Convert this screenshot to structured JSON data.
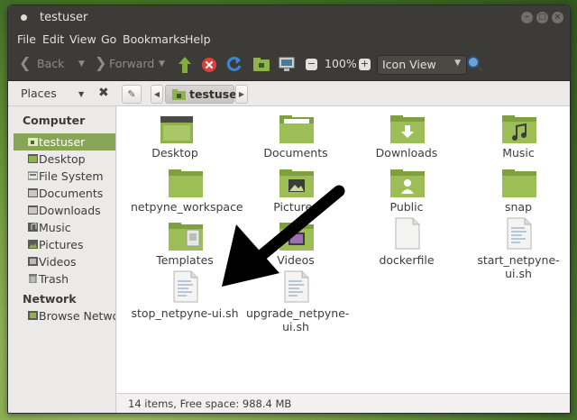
{
  "window": {
    "title": "testuser"
  },
  "menu": [
    "File",
    "Edit",
    "View",
    "Go",
    "Bookmarks",
    "Help"
  ],
  "toolbar": {
    "back_label": "Back",
    "forward_label": "Forward",
    "zoom": "100%",
    "view_mode": "Icon View"
  },
  "location": {
    "places_label": "Places",
    "current_folder": "testuser"
  },
  "sidebar": {
    "computer_header": "Computer",
    "network_header": "Network",
    "items": [
      {
        "label": "testuser",
        "icon": "home-icon",
        "selected": true
      },
      {
        "label": "Desktop",
        "icon": "desktop-icon"
      },
      {
        "label": "File System",
        "icon": "drive-icon"
      },
      {
        "label": "Documents",
        "icon": "folder-icon"
      },
      {
        "label": "Downloads",
        "icon": "folder-icon"
      },
      {
        "label": "Music",
        "icon": "music-icon"
      },
      {
        "label": "Pictures",
        "icon": "pictures-icon"
      },
      {
        "label": "Videos",
        "icon": "videos-icon"
      },
      {
        "label": "Trash",
        "icon": "trash-icon"
      }
    ],
    "network_items": [
      {
        "label": "Browse Network",
        "icon": "network-icon"
      }
    ]
  },
  "files": [
    {
      "name": "Desktop",
      "type": "folder-desktop"
    },
    {
      "name": "Documents",
      "type": "folder-documents"
    },
    {
      "name": "Downloads",
      "type": "folder-downloads"
    },
    {
      "name": "Music",
      "type": "folder-music"
    },
    {
      "name": "netpyne_workspace",
      "type": "folder"
    },
    {
      "name": "Pictures",
      "type": "folder-pictures"
    },
    {
      "name": "Public",
      "type": "folder-public"
    },
    {
      "name": "snap",
      "type": "folder"
    },
    {
      "name": "Templates",
      "type": "folder-templates"
    },
    {
      "name": "Videos",
      "type": "folder-videos"
    },
    {
      "name": "dockerfile",
      "type": "file"
    },
    {
      "name": "start_netpyne-ui.sh",
      "type": "script"
    },
    {
      "name": "stop_netpyne-ui.sh",
      "type": "script"
    },
    {
      "name": "upgrade_netpyne-ui.sh",
      "type": "script"
    }
  ],
  "status": "14 items, Free space: 988.4 MB",
  "colors": {
    "accent": "#87a556",
    "folder": "#8fb24a",
    "titlebar": "#3c3b37",
    "annotation_arrow": "#000000"
  }
}
